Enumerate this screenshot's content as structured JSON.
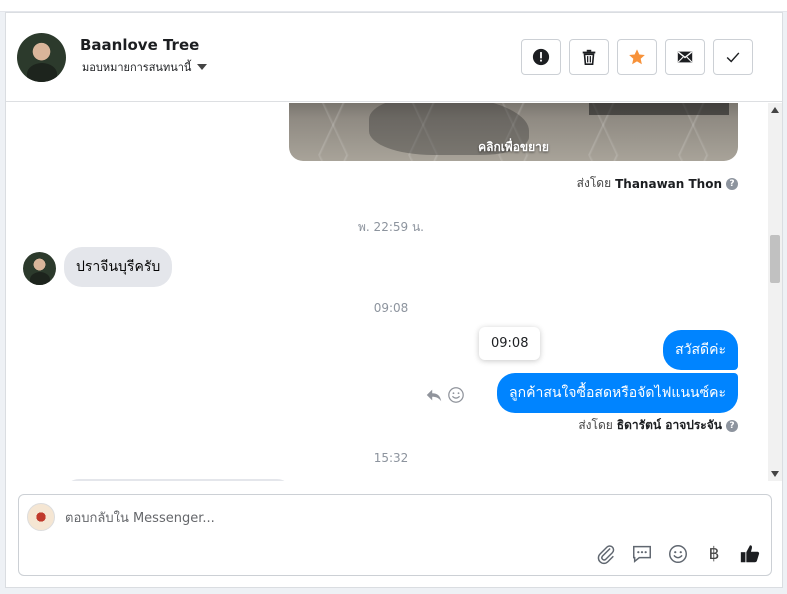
{
  "header": {
    "page_name": "Baanlove Tree",
    "assign_label": "มอบหมายการสนทนานี้"
  },
  "actions": [
    {
      "name": "spam-button",
      "icon": "alert-icon",
      "active": false
    },
    {
      "name": "delete-button",
      "icon": "trash-icon",
      "active": false
    },
    {
      "name": "star-button",
      "icon": "star-icon",
      "active": true,
      "color": "#f7923a"
    },
    {
      "name": "mark-unread-button",
      "icon": "envelope-icon",
      "active": false
    },
    {
      "name": "done-button",
      "icon": "check-icon",
      "active": false
    }
  ],
  "conversation": {
    "image_caption": "คลิกเพื่อขยาย",
    "sent_by_1": {
      "prefix": "ส่งโดย",
      "name": "Thanawan Thon"
    },
    "timestamp_1": "พ. 22:59 น.",
    "incoming_1": "ปราจีนบุรีครับ",
    "timestamp_2": "09:08",
    "tooltip": "09:08",
    "outgoing_1": "สวัสดีค่ะ",
    "outgoing_2": "ลูกค้าสนใจซื้อสดหรือจัดไฟแนนซ์คะ",
    "sent_by_2": {
      "prefix": "ส่งโดย",
      "name": "ธิดารัตน์ อาจประจัน"
    },
    "timestamp_3": "15:32"
  },
  "composer": {
    "placeholder": "ตอบกลับใน Messenger...",
    "currency_symbol": "฿"
  },
  "colors": {
    "accent": "#0084ff",
    "star": "#f7923a",
    "incoming_bubble": "#e4e6eb"
  }
}
